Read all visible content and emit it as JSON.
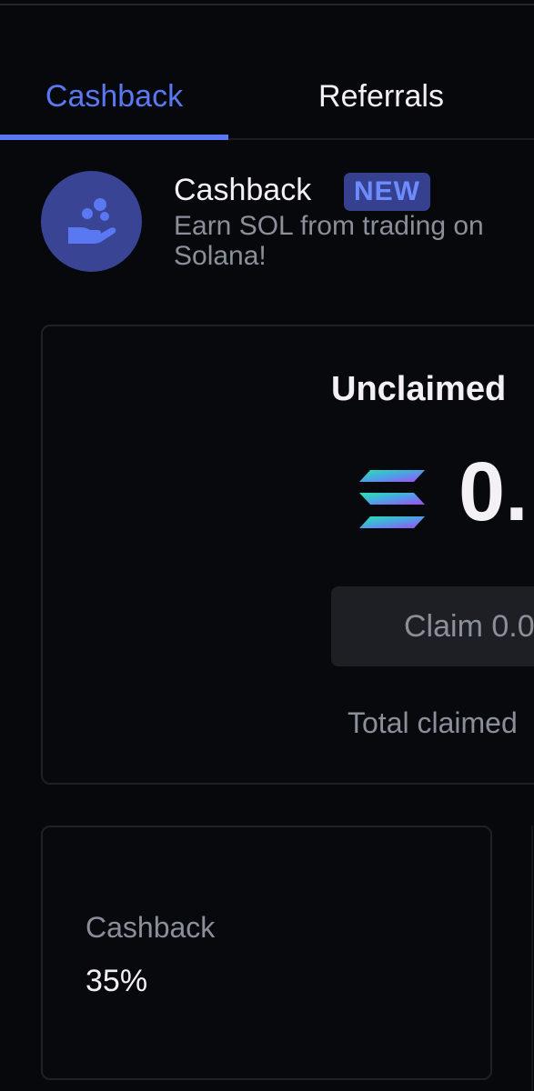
{
  "tabs": [
    {
      "label": "Cashback",
      "active": true
    },
    {
      "label": "Referrals",
      "active": false
    }
  ],
  "header": {
    "icon": "hand-coins-icon",
    "title": "Cashback",
    "badge": "NEW",
    "subtitle": "Earn SOL from trading on\nSolana!"
  },
  "claim_card": {
    "label": "Unclaimed",
    "currency_icon": "solana-logo-icon",
    "amount": "0.",
    "claim_button_label": "Claim 0.0",
    "total_claimed_label": "Total claimed"
  },
  "stats": {
    "label": "Cashback",
    "value": "35%"
  },
  "colors": {
    "background": "#06080c",
    "accent": "#5a78f2",
    "badge_bg": "#35408f",
    "muted_text": "#8a8f9a",
    "card_border": "#1f2127"
  }
}
